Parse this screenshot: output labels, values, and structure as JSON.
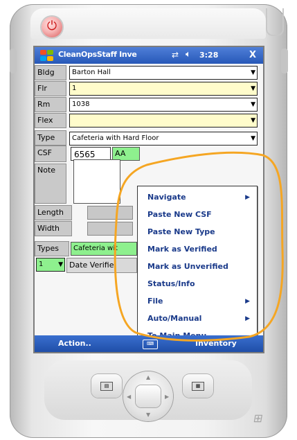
{
  "window": {
    "app_title": "CleanOpsStaff Inve",
    "clock": "3:28",
    "close_label": "X",
    "connectivity_icon": "connectivity-icon",
    "volume_icon": "speaker-icon"
  },
  "form": {
    "bldg": {
      "label": "Bldg",
      "value": "Barton Hall"
    },
    "flr": {
      "label": "Flr",
      "value": "1"
    },
    "rm": {
      "label": "Rm",
      "value": "1038"
    },
    "flex": {
      "label": "Flex",
      "value": ""
    },
    "type": {
      "label": "Type",
      "value": "Cafeteria with Hard Floor"
    },
    "csf": {
      "label": "CSF",
      "value": "6565",
      "extra": "AA"
    },
    "note": {
      "label": "Note",
      "value": ""
    },
    "length": {
      "label": "Length"
    },
    "width": {
      "label": "Width"
    },
    "types": {
      "label": "Types",
      "value": "Cafeteria wit"
    },
    "count": {
      "value": "1"
    },
    "date_verified": {
      "label": "Date Verifie"
    }
  },
  "context_menu": {
    "items": [
      {
        "label": "Navigate",
        "submenu": true
      },
      {
        "label": "Paste New CSF",
        "submenu": false
      },
      {
        "label": "Paste New Type",
        "submenu": false
      },
      {
        "label": "Mark as Verified",
        "submenu": false
      },
      {
        "label": "Mark as Unverified",
        "submenu": false
      },
      {
        "label": "Status/Info",
        "submenu": false
      },
      {
        "label": "File",
        "submenu": true
      },
      {
        "label": "Auto/Manual",
        "submenu": true
      },
      {
        "label": "To Main Menu",
        "submenu": false
      }
    ]
  },
  "menu_bar": {
    "left_label": "Action..",
    "right_label": "Inventory"
  },
  "colors": {
    "annotation": "#f5a623",
    "title_bar": "#2758b8",
    "yellow_field": "#fffccb",
    "green_field": "#8ef08e",
    "menu_text": "#1a3a8a"
  }
}
